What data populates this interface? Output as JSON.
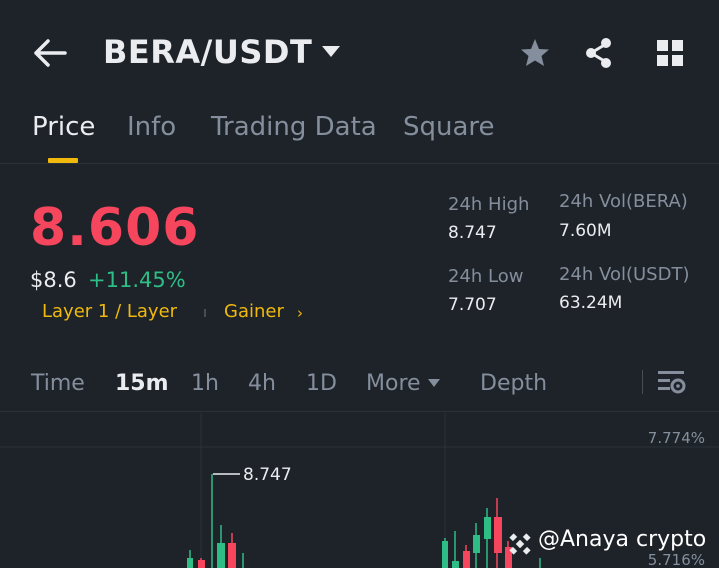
{
  "header": {
    "title": "BERA/USDT",
    "icons": [
      "back-arrow-icon",
      "caret-down-icon",
      "star-icon",
      "share-icon",
      "grid-icon"
    ]
  },
  "tabs": [
    {
      "label": "Price",
      "active": true
    },
    {
      "label": "Info",
      "active": false
    },
    {
      "label": "Trading Data",
      "active": false
    },
    {
      "label": "Square",
      "active": false
    }
  ],
  "ticker": {
    "last_price": "8.606",
    "usd_price": "$8.6",
    "change_pct": "+11.45%",
    "tags": [
      "Layer 1 / Layer",
      "Gainer"
    ]
  },
  "stats": {
    "high_label": "24h High",
    "high_value": "8.747",
    "low_label": "24h Low",
    "low_value": "7.707",
    "vol_base_label": "24h Vol(BERA)",
    "vol_base_value": "7.60M",
    "vol_quote_label": "24h Vol(USDT)",
    "vol_quote_value": "63.24M"
  },
  "intervals": [
    {
      "label": "Time",
      "active": false
    },
    {
      "label": "15m",
      "active": true
    },
    {
      "label": "1h",
      "active": false
    },
    {
      "label": "4h",
      "active": false
    },
    {
      "label": "1D",
      "active": false
    },
    {
      "label": "More",
      "active": false
    },
    {
      "label": "Depth",
      "active": false
    }
  ],
  "chart": {
    "max_label": "8.747",
    "scale_top": "7.774%",
    "scale_second": "5.716%"
  },
  "watermark": "@Anaya crypto",
  "colors": {
    "background": "#1e2329",
    "up": "#2ebd85",
    "down": "#f6465d",
    "accent": "#f0b90b",
    "muted": "#848e9c"
  }
}
